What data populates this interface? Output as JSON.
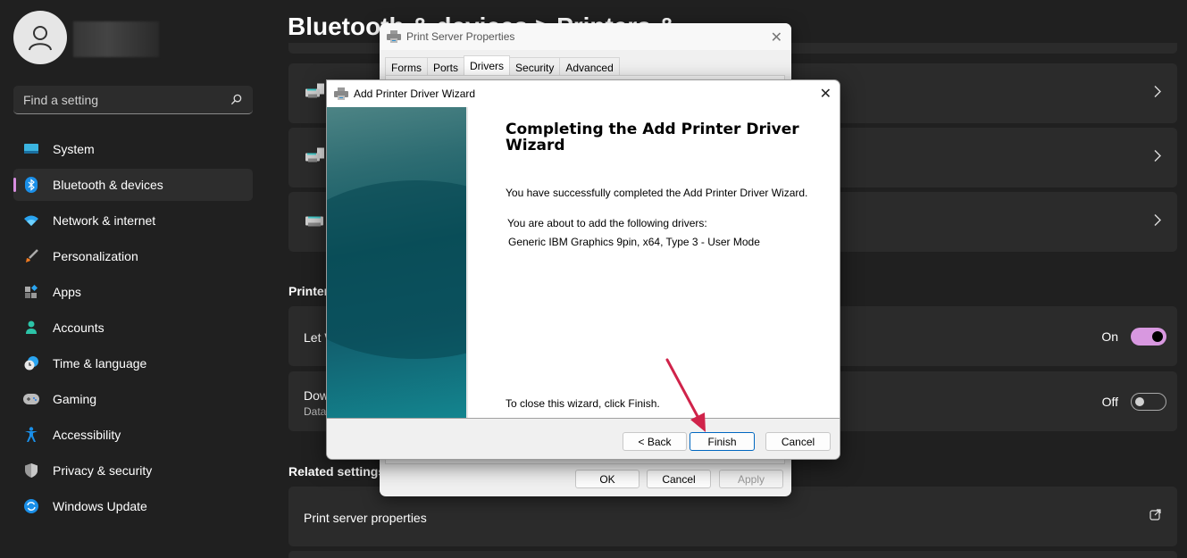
{
  "sidebar": {
    "search_placeholder": "Find a setting",
    "items": [
      {
        "label": "System",
        "icon": "monitor-icon"
      },
      {
        "label": "Bluetooth & devices",
        "icon": "bluetooth-icon",
        "active": true
      },
      {
        "label": "Network & internet",
        "icon": "wifi-icon"
      },
      {
        "label": "Personalization",
        "icon": "brush-icon"
      },
      {
        "label": "Apps",
        "icon": "apps-icon"
      },
      {
        "label": "Accounts",
        "icon": "person-icon"
      },
      {
        "label": "Time & language",
        "icon": "clock-globe-icon"
      },
      {
        "label": "Gaming",
        "icon": "gamepad-icon"
      },
      {
        "label": "Accessibility",
        "icon": "accessibility-icon"
      },
      {
        "label": "Privacy & security",
        "icon": "shield-icon"
      },
      {
        "label": "Windows Update",
        "icon": "sync-icon"
      }
    ],
    "accent": "#d88ee0"
  },
  "main": {
    "title": "Bluetooth & devices  >  Printers &",
    "printer_section_label": "Printer",
    "settings": [
      {
        "label": "Let W",
        "state": "On"
      },
      {
        "label": "Dow",
        "sub": "Data",
        "state": "Off"
      }
    ],
    "related_label": "Related settings",
    "related_items": [
      {
        "label": "Print server properties",
        "icon": "open-external-icon"
      }
    ]
  },
  "print_server_dialog": {
    "title": "Print Server Properties",
    "tabs": [
      "Forms",
      "Ports",
      "Drivers",
      "Security",
      "Advanced"
    ],
    "active_tab": "Drivers",
    "buttons": {
      "ok": "OK",
      "cancel": "Cancel",
      "apply": "Apply"
    }
  },
  "wizard": {
    "title": "Add Printer Driver Wizard",
    "heading": "Completing the Add Printer Driver Wizard",
    "success_text": "You have successfully completed the Add Printer Driver Wizard.",
    "about_text": "You are about to add the following drivers:",
    "driver_text": "Generic IBM Graphics 9pin, x64, Type 3 - User Mode",
    "close_hint": "To close this wizard, click Finish.",
    "buttons": {
      "back": "< Back",
      "finish": "Finish",
      "cancel": "Cancel"
    }
  },
  "annotation": {
    "arrow_color": "#d0234a",
    "target": "Finish"
  }
}
